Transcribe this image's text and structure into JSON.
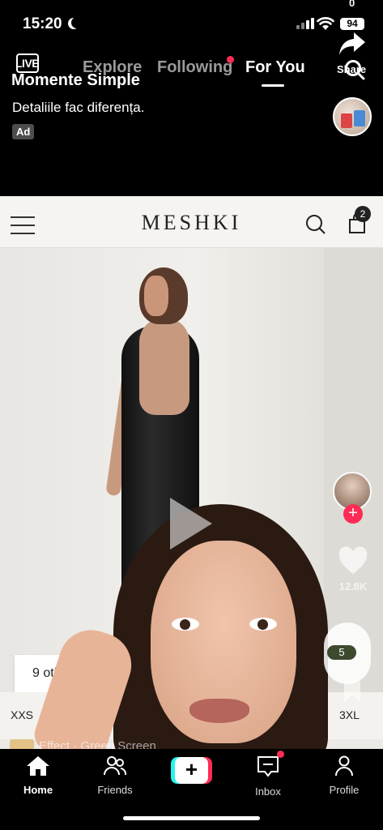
{
  "status_bar": {
    "time": "15:20",
    "battery": "94",
    "top_count": "0"
  },
  "top_nav": {
    "live_label": "LIVE",
    "tabs": [
      {
        "label": "Explore"
      },
      {
        "label": "Following"
      },
      {
        "label": "For You"
      }
    ],
    "active_tab": "For You"
  },
  "share": {
    "label": "Share"
  },
  "ad": {
    "title": "Momente Simple",
    "description": "Detaliile fac diferența.",
    "badge": "Ad"
  },
  "video": {
    "brand": "MESHKI",
    "bag_count": "2",
    "other_colors": "9 other col",
    "size_min": "XXS",
    "size_max": "3XL",
    "effect": "Effect · Green Screen"
  },
  "right_rail": {
    "like_count": "12.8K",
    "comment_count": "5"
  },
  "tab_bar": {
    "home": "Home",
    "friends": "Friends",
    "create": "+",
    "inbox": "Inbox",
    "profile": "Profile"
  },
  "colors": {
    "accent": "#fe2c55",
    "create_cyan": "#25f4ee"
  }
}
